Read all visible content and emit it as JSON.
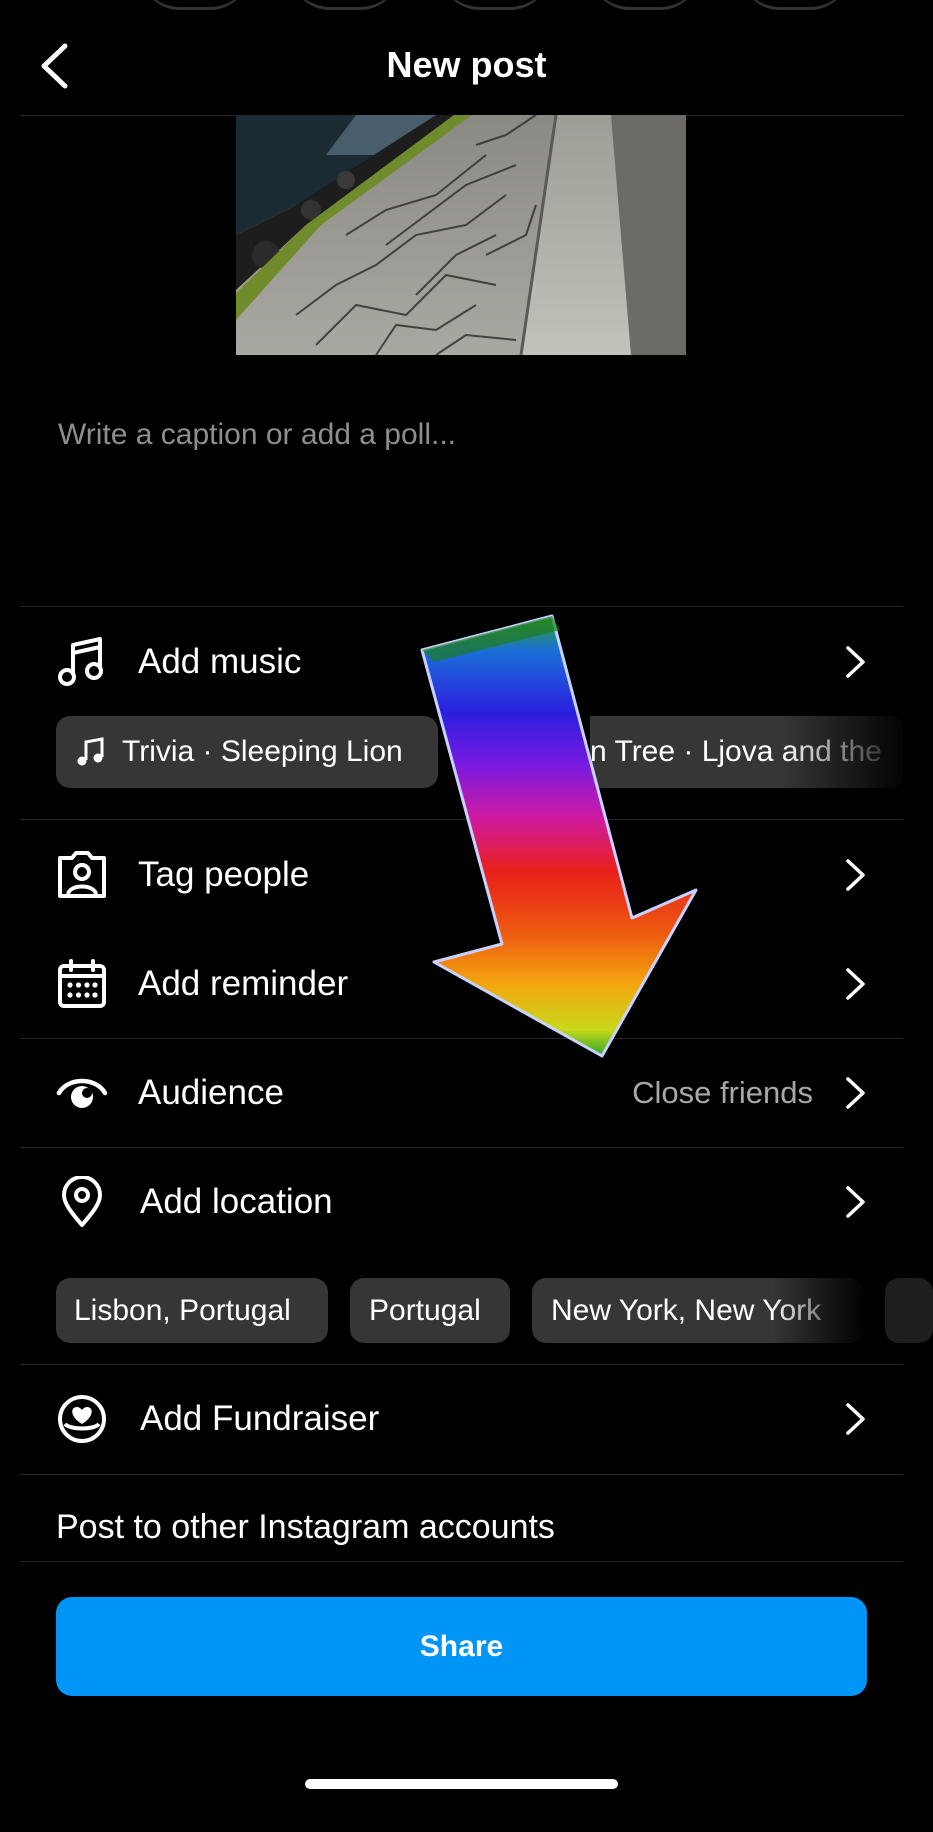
{
  "header": {
    "title": "New post"
  },
  "caption": {
    "placeholder": "Write a caption or add a poll..."
  },
  "music": {
    "label": "Add music",
    "suggestions": [
      "Trivia · Sleeping Lion",
      "n Tree · Ljova and the"
    ]
  },
  "tag_people": {
    "label": "Tag people"
  },
  "reminder": {
    "label": "Add reminder"
  },
  "audience": {
    "label": "Audience",
    "value": "Close friends"
  },
  "location": {
    "label": "Add location",
    "suggestions": [
      "Lisbon, Portugal",
      "Portugal",
      "New York, New York"
    ]
  },
  "fundraiser": {
    "label": "Add Fundraiser"
  },
  "other_accounts": {
    "label": "Post to other Instagram accounts"
  },
  "share": {
    "label": "Share"
  },
  "colors": {
    "accent": "#0095f6",
    "background": "#000000",
    "chip": "#363636",
    "muted": "#a8a8a8"
  },
  "icons": [
    "back-chevron-icon",
    "music-note-icon",
    "tag-person-icon",
    "calendar-icon",
    "eye-icon",
    "location-pin-icon",
    "fundraiser-heart-icon",
    "chevron-right-icon"
  ]
}
